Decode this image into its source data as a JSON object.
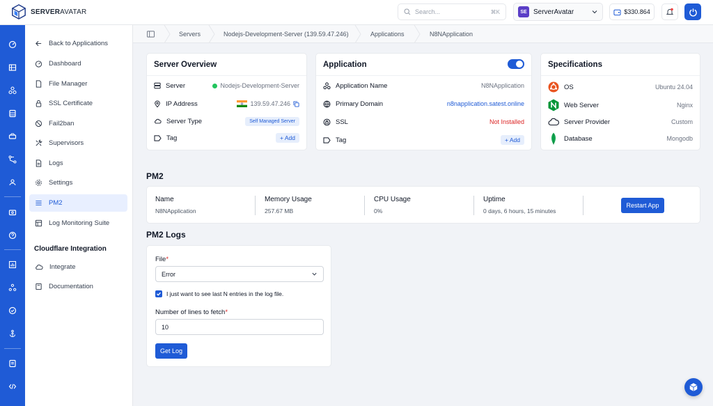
{
  "brand": {
    "name_bold": "SERVER",
    "name_thin": "AVATAR"
  },
  "search": {
    "placeholder": "Search...",
    "shortcut": "⌘K"
  },
  "org": {
    "initials": "SE",
    "name": "ServerAvatar"
  },
  "wallet": {
    "amount": "$330.864"
  },
  "sidebar": {
    "back": "Back to Applications",
    "items": [
      {
        "label": "Dashboard",
        "icon": "dashboard-icon"
      },
      {
        "label": "File Manager",
        "icon": "file-icon"
      },
      {
        "label": "SSL Certificate",
        "icon": "lock-icon"
      },
      {
        "label": "Fail2ban",
        "icon": "ban-icon"
      },
      {
        "label": "Supervisors",
        "icon": "tools-icon"
      },
      {
        "label": "Logs",
        "icon": "log-icon"
      },
      {
        "label": "Settings",
        "icon": "gear-icon"
      },
      {
        "label": "PM2",
        "icon": "list-icon",
        "active": true
      },
      {
        "label": "Log Monitoring Suite",
        "icon": "monitor-icon"
      }
    ],
    "section": "Cloudflare Integration",
    "section_items": [
      {
        "label": "Integrate",
        "icon": "cloud-icon"
      },
      {
        "label": "Documentation",
        "icon": "book-icon"
      }
    ]
  },
  "breadcrumb": [
    "Servers",
    "Nodejs-Development-Server (139.59.47.246)",
    "Applications",
    "N8NApplication"
  ],
  "server_overview": {
    "title": "Server Overview",
    "server_label": "Server",
    "server_value": "Nodejs-Development-Server",
    "ip_label": "IP Address",
    "ip_value": "139.59.47.246",
    "type_label": "Server Type",
    "type_value": "Self Managed Server",
    "tag_label": "Tag",
    "add_label": "+ Add"
  },
  "application": {
    "title": "Application",
    "name_label": "Application Name",
    "name_value": "N8NApplication",
    "domain_label": "Primary Domain",
    "domain_value": "n8napplication.satest.online",
    "ssl_label": "SSL",
    "ssl_value": "Not Installed",
    "tag_label": "Tag",
    "add_label": "+ Add",
    "enabled": true
  },
  "specifications": {
    "title": "Specifications",
    "os_label": "OS",
    "os_value": "Ubuntu 24.04",
    "web_label": "Web Server",
    "web_value": "Nginx",
    "provider_label": "Server Provider",
    "provider_value": "Custom",
    "db_label": "Database",
    "db_value": "Mongodb"
  },
  "pm2": {
    "title": "PM2",
    "name_h": "Name",
    "name_v": "N8NApplication",
    "mem_h": "Memory Usage",
    "mem_v": "257.67 MB",
    "cpu_h": "CPU Usage",
    "cpu_v": "0%",
    "uptime_h": "Uptime",
    "uptime_v": "0 days, 6 hours, 15 minutes",
    "restart_label": "Restart App"
  },
  "pm2_logs": {
    "title": "PM2 Logs",
    "file_label": "File",
    "file_value": "Error",
    "checkbox_label": "I just want to see last N entries in the log file.",
    "checkbox_checked": true,
    "lines_label": "Number of lines to fetch",
    "lines_value": "10",
    "get_label": "Get Log"
  },
  "colors": {
    "primary": "#1f5bd6",
    "success": "#22c55e",
    "danger": "#dc2626"
  }
}
